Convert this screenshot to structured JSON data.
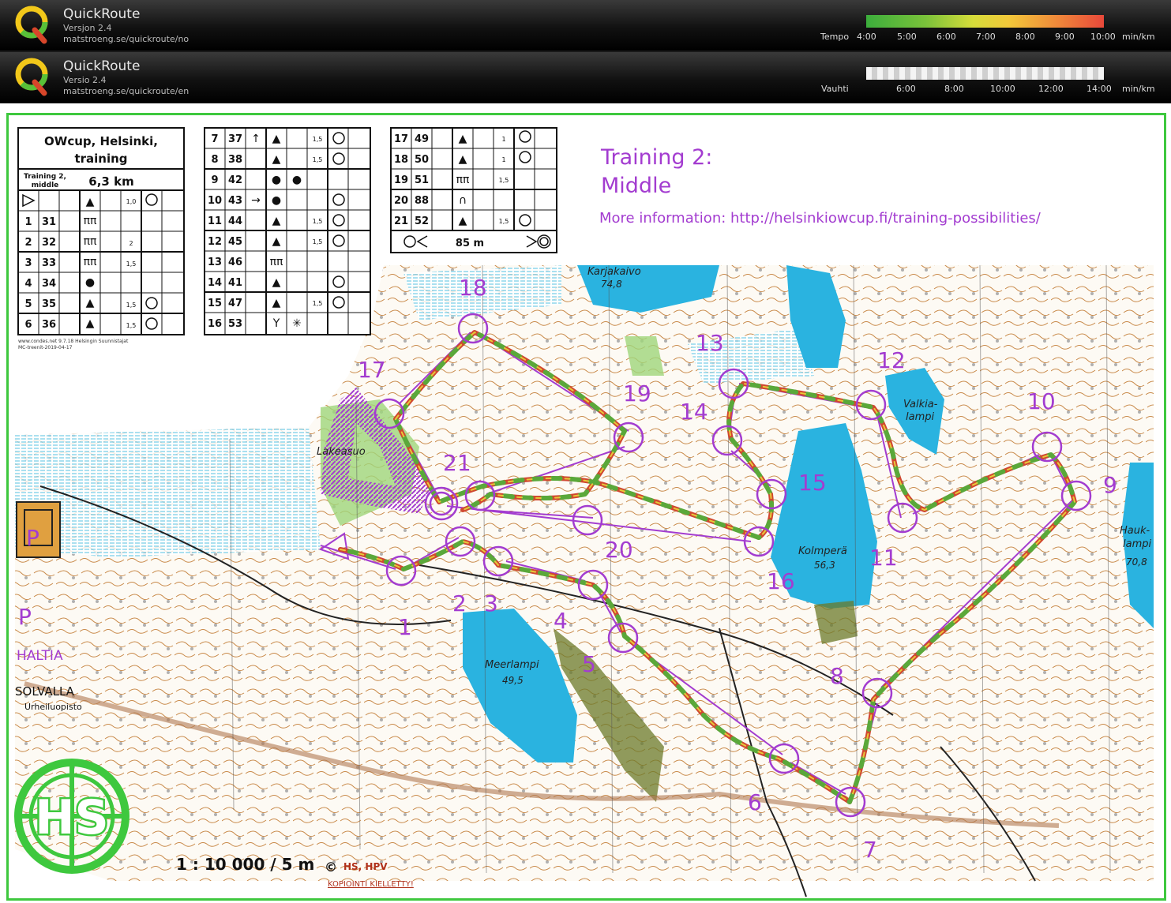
{
  "app_bars": [
    {
      "name": "QuickRoute",
      "version": "Versjon 2.4",
      "url": "matstroeng.se/quickroute/no",
      "legend_title": "Tempo",
      "ticks": [
        "4:00",
        "5:00",
        "6:00",
        "7:00",
        "8:00",
        "9:00",
        "10:00"
      ],
      "unit": "min/km"
    },
    {
      "name": "QuickRoute",
      "version": "Versio 2.4",
      "url": "matstroeng.se/quickroute/en",
      "legend_title": "Vauhti",
      "ticks": [
        "6:00",
        "8:00",
        "10:00",
        "12:00",
        "14:00"
      ],
      "unit": "min/km"
    }
  ],
  "colors": {
    "route_purple": "#a33cd0",
    "frame_green": "#3ec83e",
    "water": "#2ab3e0",
    "forest_green": "#6b7a2a",
    "contour": "#b8702a"
  },
  "control_card": {
    "title": "OWcup, Helsinki, training",
    "class_label": "Training 2, middle",
    "length": "6,3 km",
    "rows_a": [
      {
        "n": "1",
        "code": "31",
        "d1": "",
        "sym": "▲",
        "size": "",
        "d2": ""
      },
      {
        "n": "2",
        "code": "32",
        "d1": "",
        "sym": "",
        "size": "2",
        "d2": ""
      },
      {
        "n": "3",
        "code": "33",
        "d1": "",
        "sym": "",
        "size": "1,5",
        "d2": ""
      },
      {
        "n": "4",
        "code": "34",
        "d1": "",
        "sym": "●",
        "size": "",
        "d2": ""
      },
      {
        "n": "5",
        "code": "35",
        "d1": "",
        "sym": "▲",
        "size": "1,5",
        "d2": ""
      },
      {
        "n": "6",
        "code": "36",
        "d1": "",
        "sym": "▲",
        "size": "1,5",
        "d2": ""
      }
    ],
    "start_size": "1,0",
    "rows_b": [
      {
        "n": "7",
        "code": "37",
        "size": "1,5"
      },
      {
        "n": "8",
        "code": "38",
        "size": "1,5"
      },
      {
        "n": "9",
        "code": "42",
        "size": ""
      },
      {
        "n": "10",
        "code": "43",
        "size": ""
      },
      {
        "n": "11",
        "code": "44",
        "size": "1,5"
      },
      {
        "n": "12",
        "code": "45",
        "size": "1,5"
      },
      {
        "n": "13",
        "code": "46",
        "size": ""
      },
      {
        "n": "14",
        "code": "41",
        "size": ""
      },
      {
        "n": "15",
        "code": "47",
        "size": "1,5"
      },
      {
        "n": "16",
        "code": "53",
        "size": ""
      }
    ],
    "rows_c": [
      {
        "n": "17",
        "code": "49",
        "size": "1"
      },
      {
        "n": "18",
        "code": "50",
        "size": "1"
      },
      {
        "n": "19",
        "code": "51",
        "size": "1,5"
      },
      {
        "n": "20",
        "code": "88",
        "size": ""
      },
      {
        "n": "21",
        "code": "52",
        "size": "1,5"
      }
    ],
    "finish_distance": "85 m",
    "footer1": "www.condes.net 9.7.18 Helsingin Suunnistajat",
    "footer2": "MC-treenit-2019-04-17"
  },
  "heading": {
    "line1": "Training 2:",
    "line2": "Middle",
    "info": "More information: http://helsinkiowcup.fi/training-possibilities/"
  },
  "map_labels": {
    "karjakaivo": "Karjakaivo",
    "karjakaivo_h": "74,8",
    "valkialampi1": "Valkia-",
    "valkialampi2": "lampi",
    "lakeasuo": "Lakeasuo",
    "kolmpera": "Kolmperä",
    "kolmpera_h": "56,3",
    "meerlampi": "Meerlampi",
    "meerlampi_h": "49,5",
    "hauk1": "Hauk-",
    "hauk2": "lampi",
    "hauk_h": "70,8",
    "haltia": "HALTIA",
    "solvalla": "SOLVALLA",
    "urheilu": "Urheiluopisto",
    "parking": "P"
  },
  "controls": [
    "1",
    "2",
    "3",
    "4",
    "5",
    "6",
    "7",
    "8",
    "9",
    "10",
    "11",
    "12",
    "13",
    "14",
    "15",
    "16",
    "17",
    "18",
    "19",
    "20",
    "21"
  ],
  "footer": {
    "scale": "1 : 10 000 / 5 m",
    "copyright": "©",
    "copyright_by": "HS, HPV",
    "copy_notice": "KOPIOINTI  KIELLETTY!",
    "club_logo": "HS"
  }
}
